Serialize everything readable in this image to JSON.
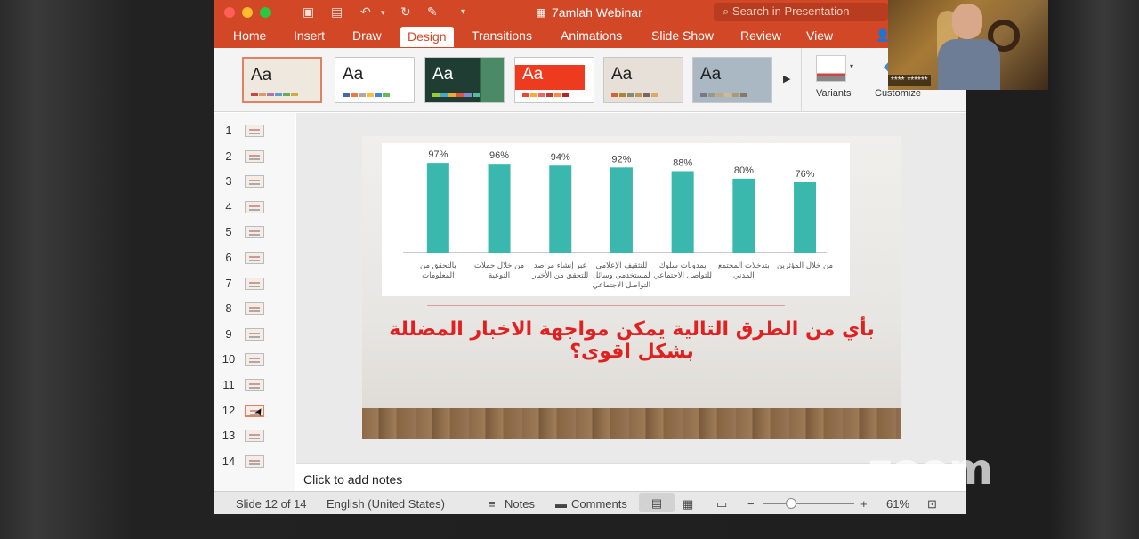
{
  "window": {
    "title": "7amlah Webinar",
    "search_placeholder": "Search in Presentation"
  },
  "tabs": [
    {
      "label": "Home"
    },
    {
      "label": "Insert"
    },
    {
      "label": "Draw"
    },
    {
      "label": "Design"
    },
    {
      "label": "Transitions"
    },
    {
      "label": "Animations"
    },
    {
      "label": "Slide Show"
    },
    {
      "label": "Review"
    },
    {
      "label": "View"
    }
  ],
  "active_tab": "Design",
  "ribbon": {
    "themes": [
      {
        "label": "Aa"
      },
      {
        "label": "Aa"
      },
      {
        "label": "Aa"
      },
      {
        "label": "Aa"
      },
      {
        "label": "Aa"
      },
      {
        "label": "Aa"
      }
    ],
    "variants_label": "Variants",
    "customize_label": "Customize"
  },
  "slides": {
    "numbers": [
      "1",
      "2",
      "3",
      "4",
      "5",
      "6",
      "7",
      "8",
      "9",
      "10",
      "11",
      "12",
      "13",
      "14"
    ],
    "current": 12
  },
  "slide": {
    "question": "بأي من الطرق التالية يمكن مواجهة الاخبار المضللة بشكل اقوى؟"
  },
  "chart_data": {
    "type": "bar",
    "categories": [
      "بالتحقق من المعلومات",
      "من خلال حملات التوعية",
      "عبر إنشاء مراصد للتحقق من الأخبار",
      "للتثقيف الإعلامي لمستخدمي وسائل التواصل الاجتماعي",
      "بمدونات سلوك للتواصل الاجتماعي",
      "بتدخلات المجتمع المدني",
      "من خلال المؤثرين"
    ],
    "values": [
      97,
      96,
      94,
      92,
      88,
      80,
      76
    ],
    "value_labels": [
      "97%",
      "96%",
      "94%",
      "92%",
      "88%",
      "80%",
      "76%"
    ],
    "ylim": [
      0,
      100
    ],
    "bar_color": "#3bb8ad"
  },
  "notes": {
    "placeholder": "Click to add notes"
  },
  "status": {
    "slide_info": "Slide 12 of 14",
    "language": "English (United States)",
    "notes_label": "Notes",
    "comments_label": "Comments",
    "zoom_level": "61%"
  },
  "webcam": {
    "name": "**** ******"
  },
  "overlay": {
    "logo_text": "zoom"
  },
  "colors": {
    "accent": "#d24726",
    "chart_bar": "#3bb8ad",
    "question_text": "#e02121"
  }
}
